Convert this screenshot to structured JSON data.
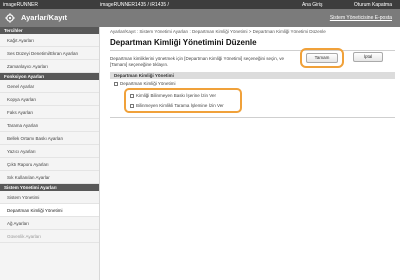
{
  "topbar": {
    "device": "imageRUNNER",
    "model": "imageRUNNER1435 / iR1435 /",
    "login": "Ana Giriş",
    "logout": "Oturum Kapatma"
  },
  "header": {
    "title": "Ayarlar/Kayıt",
    "admin_mail": "Sistem Yöneticisine E-posta"
  },
  "sidebar": {
    "sections": [
      {
        "title": "Tercihler",
        "items": [
          {
            "label": "Kağıt Ayarları"
          },
          {
            "label": "Ses Düzeyi Denetimi/Ekran Ayarları"
          },
          {
            "label": "Zamanlayıcı Ayarları"
          }
        ]
      },
      {
        "title": "Fonksiyon Ayarları",
        "items": [
          {
            "label": "Genel Ayarlar"
          },
          {
            "label": "Kopya Ayarları"
          },
          {
            "label": "Faks Ayarları"
          },
          {
            "label": "Tarama Ayarları"
          },
          {
            "label": "Bellek Ortamı Baskı Ayarları"
          },
          {
            "label": "Yazıcı Ayarları"
          },
          {
            "label": "Çıktı Raporu Ayarları"
          },
          {
            "label": "Sık Kullanılan Ayarlar"
          }
        ]
      },
      {
        "title": "Sistem Yönetimi Ayarları",
        "items": [
          {
            "label": "Sistem Yönetimi"
          },
          {
            "label": "Departman Kimliği Yönetimi",
            "active": true
          },
          {
            "label": "Ağ Ayarları"
          },
          {
            "label": "Güvenlik Ayarları",
            "faded": true
          }
        ]
      }
    ]
  },
  "main": {
    "breadcrumb": "Ayarlar/Kayıt : Sistem Yönetimi Ayarları : Departman Kimliği Yönetimi > Departman Kimliği Yönetimi Düzenle",
    "title": "Departman Kimliği Yönetimini Düzenle",
    "description": "Departman kimliklerini yönetmek için [Departman Kimliği Yönetimi] seçeneğini seçin, ve [Tamam] seçeneğine tıklayın.",
    "ok_label": "Tamam",
    "cancel_label": "İptal",
    "panel_title": "Departman Kimliği Yönetimi",
    "manage_label": "Departman Kimliği Yönetimi",
    "opt1_label": "Kimliği Bilinmeyen Baskı İşerine İzin Ver",
    "opt2_label": "Bilinmeyen Kimlikli Tarama İşlemine İzin Ver"
  },
  "colors": {
    "highlight": "#f0a13a",
    "topbar": "#3d3d3d",
    "header": "#7b7b7b",
    "section": "#585858"
  }
}
